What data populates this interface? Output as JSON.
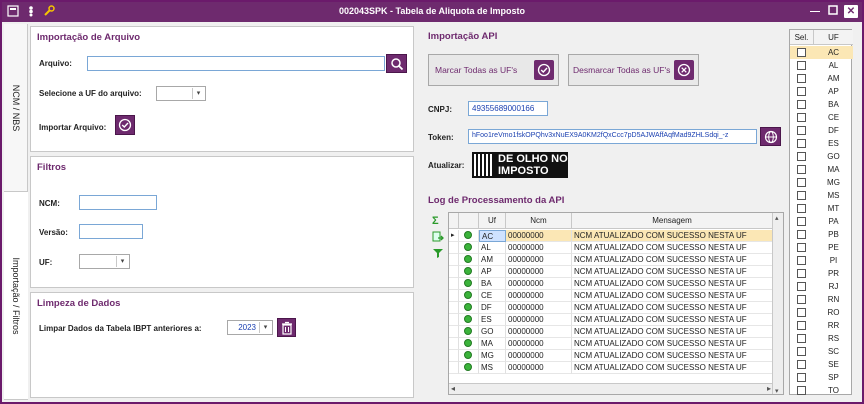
{
  "window": {
    "title": "002043SPK - Tabela de Aliquota de Imposto"
  },
  "side_tabs": [
    "NCM / NBS",
    "Importação / Filtros"
  ],
  "import_file": {
    "title": "Importação de Arquivo",
    "file_label": "Arquivo:",
    "file_value": "",
    "uf_label": "Selecione a UF do arquivo:",
    "uf_value": "",
    "import_label": "Importar Arquivo:"
  },
  "filters": {
    "title": "Filtros",
    "ncm_label": "NCM:",
    "ncm_value": "",
    "versao_label": "Versão:",
    "versao_value": "",
    "uf_label": "UF:",
    "uf_value": ""
  },
  "cleanup": {
    "title": "Limpeza de Dados",
    "label": "Limpar Dados da Tabela IBPT anteriores a:",
    "year": "2023"
  },
  "api": {
    "title": "Importação API",
    "mark_all_label": "Marcar Todas as UF's",
    "unmark_all_label": "Desmarcar Todas as UF's",
    "cnpj_label": "CNPJ:",
    "cnpj_value": "49355689000166",
    "token_label": "Token:",
    "token_value": "hFoo1reVmo1fskOPQhv3xNuEX9A0KM2fQxCcc7pD5AJWAffAqfMad9ZHLSdqi_-z",
    "update_label": "Atualizar:",
    "logo_line1": "DE OLHO NO",
    "logo_line2": "IMPOSTO"
  },
  "log": {
    "title": "Log de Processamento da API",
    "columns": [
      "Uf",
      "Ncm",
      "Mensagem"
    ],
    "rows": [
      {
        "uf": "AC",
        "ncm": "00000000",
        "msg": "NCM ATUALIZADO COM SUCESSO NESTA UF"
      },
      {
        "uf": "AL",
        "ncm": "00000000",
        "msg": "NCM ATUALIZADO COM SUCESSO NESTA UF"
      },
      {
        "uf": "AM",
        "ncm": "00000000",
        "msg": "NCM ATUALIZADO COM SUCESSO NESTA UF"
      },
      {
        "uf": "AP",
        "ncm": "00000000",
        "msg": "NCM ATUALIZADO COM SUCESSO NESTA UF"
      },
      {
        "uf": "BA",
        "ncm": "00000000",
        "msg": "NCM ATUALIZADO COM SUCESSO NESTA UF"
      },
      {
        "uf": "CE",
        "ncm": "00000000",
        "msg": "NCM ATUALIZADO COM SUCESSO NESTA UF"
      },
      {
        "uf": "DF",
        "ncm": "00000000",
        "msg": "NCM ATUALIZADO COM SUCESSO NESTA UF"
      },
      {
        "uf": "ES",
        "ncm": "00000000",
        "msg": "NCM ATUALIZADO COM SUCESSO NESTA UF"
      },
      {
        "uf": "GO",
        "ncm": "00000000",
        "msg": "NCM ATUALIZADO COM SUCESSO NESTA UF"
      },
      {
        "uf": "MA",
        "ncm": "00000000",
        "msg": "NCM ATUALIZADO COM SUCESSO NESTA UF"
      },
      {
        "uf": "MG",
        "ncm": "00000000",
        "msg": "NCM ATUALIZADO COM SUCESSO NESTA UF"
      },
      {
        "uf": "MS",
        "ncm": "00000000",
        "msg": "NCM ATUALIZADO COM SUCESSO NESTA UF"
      }
    ]
  },
  "uf_list": {
    "col_sel": "Sel.",
    "col_uf": "UF",
    "items": [
      "AC",
      "AL",
      "AM",
      "AP",
      "BA",
      "CE",
      "DF",
      "ES",
      "GO",
      "MA",
      "MG",
      "MS",
      "MT",
      "PA",
      "PB",
      "PE",
      "PI",
      "PR",
      "RJ",
      "RN",
      "RO",
      "RR",
      "RS",
      "SC",
      "SE",
      "SP",
      "TO"
    ]
  },
  "colors": {
    "accent": "#6e2a6e",
    "selected_row": "#fbe7b5",
    "link_blue": "#1a3fb0"
  },
  "icons": [
    "app-icon",
    "traffic-light-icon",
    "wrench-icon",
    "search-icon",
    "check-circle-icon",
    "close-circle-icon",
    "globe-icon",
    "trash-icon",
    "sigma-icon",
    "export-icon",
    "filter-icon",
    "success-icon"
  ]
}
